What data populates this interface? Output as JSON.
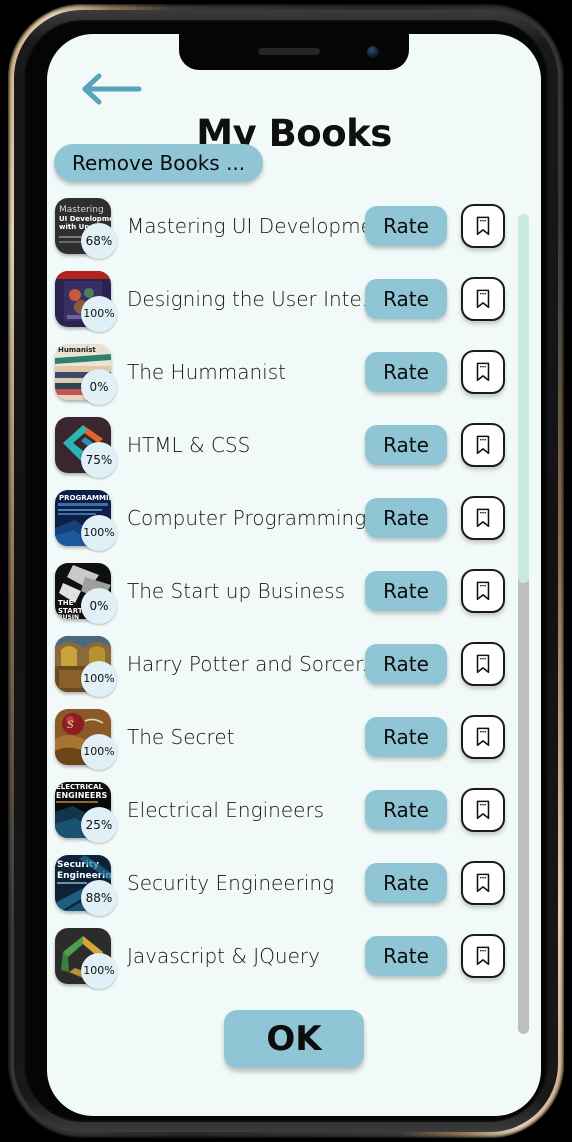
{
  "header": {
    "title": "My Books",
    "back_icon": "back-arrow-icon",
    "accent_color": "#57A3BC"
  },
  "toolbar": {
    "remove_books_label": "Remove Books ..."
  },
  "screen": {
    "background_color": "#F1FAF8",
    "button_color": "#8FC5D4",
    "badge_color": "#E1F0F6"
  },
  "scrollbar": {
    "thumb_color": "#C8EBDC",
    "track_color": "#BEBEBE",
    "thumb_percent": 45
  },
  "footer": {
    "ok_label": "OK"
  },
  "list": {
    "rate_label": "Rate",
    "bookmark_icon": "bookmark-icon",
    "books": [
      {
        "title": "Mastering UI Development",
        "percent": "68%",
        "cover": "mastering-ui"
      },
      {
        "title": "Designing the User Inte...",
        "percent": "100%",
        "cover": "designing-ui"
      },
      {
        "title": "The Hummanist",
        "percent": "0%",
        "cover": "humanist"
      },
      {
        "title": "HTML & CSS",
        "percent": "75%",
        "cover": "html-css"
      },
      {
        "title": "Computer Programming",
        "percent": "100%",
        "cover": "computer-programming"
      },
      {
        "title": "The Start up Business",
        "percent": "0%",
        "cover": "startup-business"
      },
      {
        "title": "Harry Potter and Sorcer...",
        "percent": "100%",
        "cover": "harry-potter"
      },
      {
        "title": "The Secret",
        "percent": "100%",
        "cover": "the-secret"
      },
      {
        "title": "Electrical Engineers",
        "percent": "25%",
        "cover": "electrical-engineers"
      },
      {
        "title": "Security Engineering",
        "percent": "88%",
        "cover": "security-engineering"
      },
      {
        "title": "Javascript & JQuery",
        "percent": "100%",
        "cover": "javascript-jquery"
      }
    ]
  }
}
